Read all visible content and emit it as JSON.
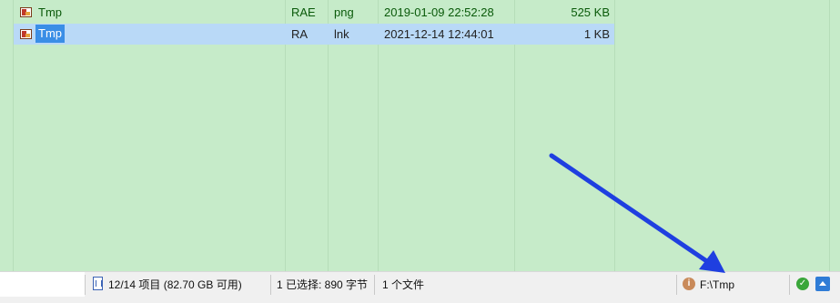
{
  "file_list": {
    "rows": [
      {
        "name": "Tmp",
        "attr": "RAE",
        "ext": "png",
        "date": "2019-01-09 22:52:28",
        "size": "525 KB",
        "selected": false
      },
      {
        "name": "Tmp",
        "attr": "RA",
        "ext": "lnk",
        "date": "2021-12-14 12:44:01",
        "size": "1 KB",
        "selected": true
      }
    ]
  },
  "statusbar": {
    "items_summary": "12/14 项目 (82.70 GB 可用)",
    "selection_summary": "1 已选择: 890 字节",
    "file_count": "1 个文件",
    "current_path": "F:\\Tmp"
  },
  "annotation": {
    "arrow_color": "#1f3fe0"
  },
  "colors": {
    "list_background": "#c6ebc9",
    "selection_row": "#b9d9f7",
    "selection_name": "#3a8ee6",
    "text_green": "#0a5a0a"
  }
}
